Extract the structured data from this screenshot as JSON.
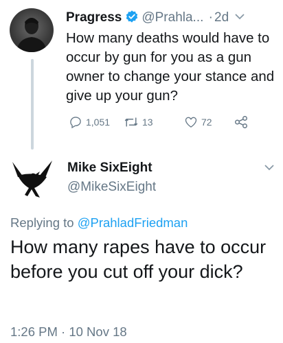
{
  "tweet1": {
    "author_name": "Pragress",
    "handle": "@Prahla...",
    "separator": "·",
    "time": "2d",
    "text": "How many deaths would have to occur by gun for you as a gun owner to change your stance and give up your gun?",
    "replies": "1,051",
    "retweets": "13",
    "likes": "72",
    "icons": {
      "verified": "verified-badge-icon",
      "menu": "chevron-down-icon",
      "reply": "reply-icon",
      "retweet": "retweet-icon",
      "like": "heart-icon",
      "share": "share-icon"
    }
  },
  "tweet2": {
    "author_name": "Mike SixEight",
    "handle": "@MikeSixEight",
    "replying_prefix": "Replying to",
    "replying_handle": "@PrahladFriedman",
    "text": "How many rapes have to occur before you cut off your dick?",
    "timestamp": "1:26 PM · 10 Nov 18",
    "icons": {
      "avatar": "raven-avatar-icon",
      "menu": "chevron-down-icon"
    }
  },
  "colors": {
    "text": "#14171a",
    "muted": "#657786",
    "link": "#1da1f2",
    "thread_line": "#ccd6dd",
    "background": "#ffffff"
  }
}
